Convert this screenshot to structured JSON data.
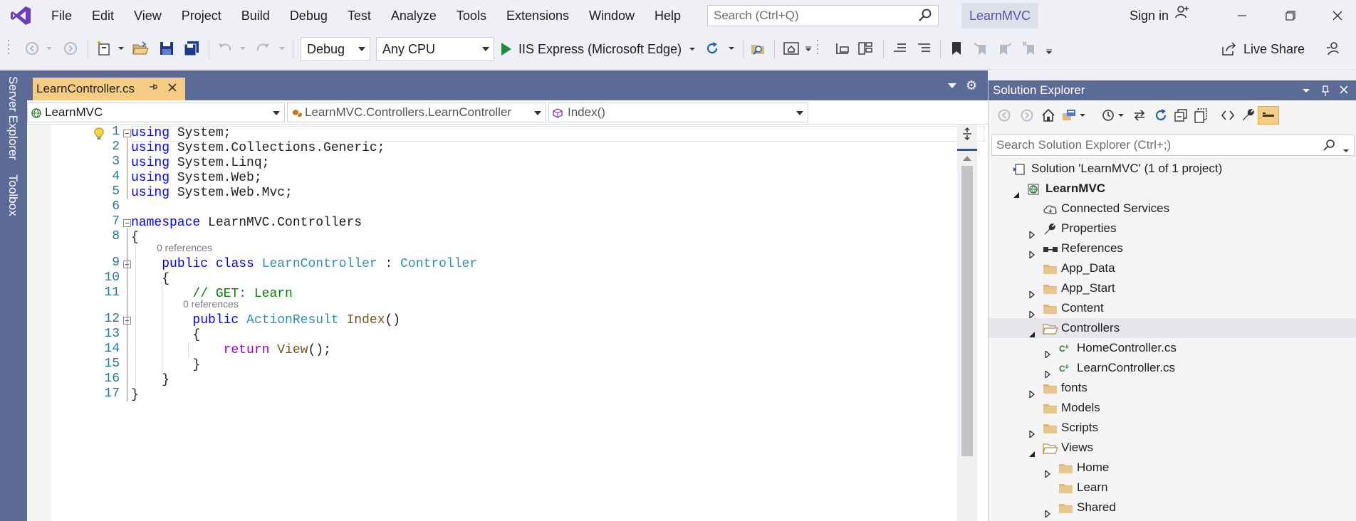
{
  "menubar": {
    "items": [
      "File",
      "Edit",
      "View",
      "Project",
      "Build",
      "Debug",
      "Test",
      "Analyze",
      "Tools",
      "Extensions",
      "Window",
      "Help"
    ],
    "search_placeholder": "Search (Ctrl+Q)",
    "project_name": "LearnMVC",
    "sign_in": "Sign in"
  },
  "toolbar": {
    "config": "Debug",
    "platform": "Any CPU",
    "run_target": "IIS Express (Microsoft Edge)",
    "live_share": "Live Share"
  },
  "side_tabs": [
    "Server Explorer",
    "Toolbox"
  ],
  "document": {
    "tab_title": "LearnController.cs",
    "nav_project": "LearnMVC",
    "nav_class": "LearnMVC.Controllers.LearnController",
    "nav_member": "Index()"
  },
  "editor": {
    "line_numbers": [
      "1",
      "2",
      "3",
      "4",
      "5",
      "6",
      "7",
      "8",
      "9",
      "10",
      "11",
      "12",
      "13",
      "14",
      "15",
      "16",
      "17"
    ],
    "code_lens": "0 references",
    "lines": [
      [
        {
          "t": "kw",
          "s": "using"
        },
        {
          "t": "",
          "s": " System;"
        }
      ],
      [
        {
          "t": "kw",
          "s": "using"
        },
        {
          "t": "",
          "s": " System.Collections.Generic;"
        }
      ],
      [
        {
          "t": "kw",
          "s": "using"
        },
        {
          "t": "",
          "s": " System.Linq;"
        }
      ],
      [
        {
          "t": "kw",
          "s": "using"
        },
        {
          "t": "",
          "s": " System.Web;"
        }
      ],
      [
        {
          "t": "kw",
          "s": "using"
        },
        {
          "t": "",
          "s": " System.Web.Mvc;"
        }
      ],
      [],
      [
        {
          "t": "kw",
          "s": "namespace"
        },
        {
          "t": "",
          "s": " LearnMVC.Controllers"
        }
      ],
      [
        {
          "t": "",
          "s": "{"
        }
      ],
      [
        {
          "t": "",
          "s": "    "
        },
        {
          "t": "kw",
          "s": "public"
        },
        {
          "t": "",
          "s": " "
        },
        {
          "t": "kw",
          "s": "class"
        },
        {
          "t": "",
          "s": " "
        },
        {
          "t": "typ",
          "s": "LearnController"
        },
        {
          "t": "",
          "s": " : "
        },
        {
          "t": "typ",
          "s": "Controller"
        }
      ],
      [
        {
          "t": "",
          "s": "    {"
        }
      ],
      [
        {
          "t": "",
          "s": "        "
        },
        {
          "t": "cmt",
          "s": "// GET: Learn"
        }
      ],
      [
        {
          "t": "",
          "s": "        "
        },
        {
          "t": "kw",
          "s": "public"
        },
        {
          "t": "",
          "s": " "
        },
        {
          "t": "typ",
          "s": "ActionResult"
        },
        {
          "t": "",
          "s": " "
        },
        {
          "t": "mth",
          "s": "Index"
        },
        {
          "t": "",
          "s": "()"
        }
      ],
      [
        {
          "t": "",
          "s": "        {"
        }
      ],
      [
        {
          "t": "",
          "s": "            "
        },
        {
          "t": "ctrl",
          "s": "return"
        },
        {
          "t": "",
          "s": " "
        },
        {
          "t": "mth",
          "s": "View"
        },
        {
          "t": "",
          "s": "();"
        }
      ],
      [
        {
          "t": "",
          "s": "        }"
        }
      ],
      [
        {
          "t": "",
          "s": "    }"
        }
      ],
      [
        {
          "t": "",
          "s": "}"
        }
      ]
    ]
  },
  "solution_explorer": {
    "title": "Solution Explorer",
    "search_placeholder": "Search Solution Explorer (Ctrl+;)",
    "nodes": [
      {
        "label": "Solution 'LearnMVC' (1 of 1 project)",
        "icon": "solution-icon",
        "expander": "none",
        "bold": false,
        "selected": false
      },
      {
        "label": "LearnMVC",
        "icon": "web-project-icon",
        "expander": "expanded",
        "bold": true,
        "selected": false
      },
      {
        "label": "Connected Services",
        "icon": "cloud-icon",
        "expander": "none",
        "bold": false,
        "selected": false
      },
      {
        "label": "Properties",
        "icon": "wrench-icon",
        "expander": "collapsed",
        "bold": false,
        "selected": false
      },
      {
        "label": "References",
        "icon": "references-icon",
        "expander": "collapsed",
        "bold": false,
        "selected": false
      },
      {
        "label": "App_Data",
        "icon": "folder-icon",
        "expander": "none",
        "bold": false,
        "selected": false
      },
      {
        "label": "App_Start",
        "icon": "folder-icon",
        "expander": "collapsed",
        "bold": false,
        "selected": false
      },
      {
        "label": "Content",
        "icon": "folder-icon",
        "expander": "collapsed",
        "bold": false,
        "selected": false
      },
      {
        "label": "Controllers",
        "icon": "folder-open-icon",
        "expander": "expanded",
        "bold": false,
        "selected": true
      },
      {
        "label": "HomeController.cs",
        "icon": "csharp-file-icon",
        "expander": "collapsed",
        "bold": false,
        "selected": false
      },
      {
        "label": "LearnController.cs",
        "icon": "csharp-file-icon",
        "expander": "collapsed",
        "bold": false,
        "selected": false
      },
      {
        "label": "fonts",
        "icon": "folder-icon",
        "expander": "collapsed",
        "bold": false,
        "selected": false
      },
      {
        "label": "Models",
        "icon": "folder-icon",
        "expander": "none",
        "bold": false,
        "selected": false
      },
      {
        "label": "Scripts",
        "icon": "folder-icon",
        "expander": "collapsed",
        "bold": false,
        "selected": false
      },
      {
        "label": "Views",
        "icon": "folder-open-icon",
        "expander": "expanded",
        "bold": false,
        "selected": false
      },
      {
        "label": "Home",
        "icon": "folder-icon",
        "expander": "collapsed",
        "bold": false,
        "selected": false
      },
      {
        "label": "Learn",
        "icon": "folder-icon",
        "expander": "none",
        "bold": false,
        "selected": false
      },
      {
        "label": "Shared",
        "icon": "folder-icon",
        "expander": "collapsed",
        "bold": false,
        "selected": false
      }
    ]
  },
  "colors": {
    "accent": "#5c6b96",
    "active_tab": "#f5cc84",
    "vs_purple": "#68217a",
    "keyword": "#0000ff",
    "type": "#2b91af",
    "comment": "#008000"
  }
}
